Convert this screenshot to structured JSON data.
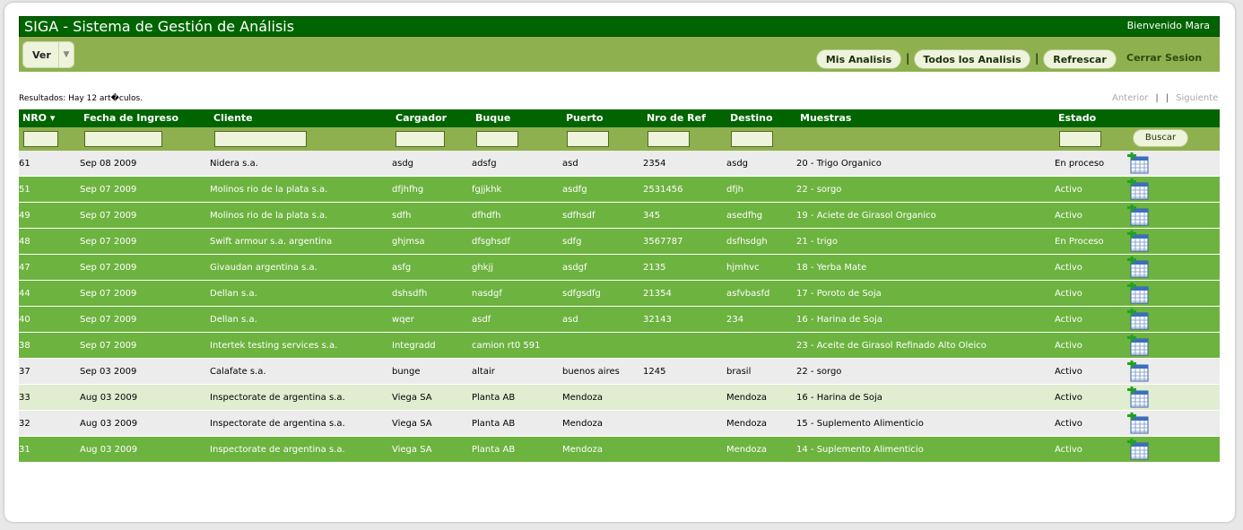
{
  "header": {
    "title": "SIGA - Sistema de Gestión de Análisis",
    "welcome": "Bienvenido Mara"
  },
  "toolbar": {
    "ver_label": "Ver",
    "mis_analisis": "Mis Analisis",
    "todos_analisis": "Todos los Analisis",
    "refrescar": "Refrescar",
    "separator": "|",
    "cerrar_sesion": "Cerrar Sesion"
  },
  "results_text": "Resultados: Hay 12 art�culos.",
  "pager": {
    "prev": "Anterior",
    "next": "Siguiente",
    "bar": "|"
  },
  "table": {
    "columns": [
      "NRO ▾",
      "Fecha de Ingreso",
      "Cliente",
      "Cargador",
      "Buque",
      "Puerto",
      "Nro de Ref",
      "Destino",
      "Muestras",
      "Estado"
    ],
    "search_button": "Buscar",
    "rows": [
      [
        "61",
        "Sep 08 2009",
        "Nidera s.a.",
        "asdg",
        "adsfg",
        "asd",
        "2354",
        "asdg",
        "20 - Trigo Organico",
        "En proceso"
      ],
      [
        "51",
        "Sep 07 2009",
        "Molinos rio de la plata s.a.",
        "dfjhfhg",
        "fgjjkhk",
        "asdfg",
        "2531456",
        "dfjh",
        "22 - sorgo",
        "Activo"
      ],
      [
        "49",
        "Sep 07 2009",
        "Molinos rio de la plata s.a.",
        "sdfh",
        "dfhdfh",
        "sdfhsdf",
        "345",
        "asedfhg",
        "19 - Aciete de Girasol Organico",
        "Activo"
      ],
      [
        "48",
        "Sep 07 2009",
        "Swift armour s.a. argentina",
        "ghjmsa",
        "dfsghsdf",
        "sdfg",
        "3567787",
        "dsfhsdgh",
        "21 - trigo",
        "En Proceso"
      ],
      [
        "47",
        "Sep 07 2009",
        "Givaudan argentina s.a.",
        "asfg",
        "ghkjj",
        "asdgf",
        "2135",
        "hjmhvc",
        "18 - Yerba Mate",
        "Activo"
      ],
      [
        "44",
        "Sep 07 2009",
        "Dellan s.a.",
        "dshsdfh",
        "nasdgf",
        "sdfgsdfg",
        "21354",
        "asfvbasfd",
        "17 - Poroto de Soja",
        "Activo"
      ],
      [
        "40",
        "Sep 07 2009",
        "Dellan s.a.",
        "wqer",
        "asdf",
        "asd",
        "32143",
        "234",
        "16 - Harina de Soja",
        "Activo"
      ],
      [
        "38",
        "Sep 07 2009",
        "Intertek testing services s.a.",
        "Integradd",
        "camion rt0 591",
        "",
        "",
        "",
        "23 - Aceite de Girasol Refinado Alto Oleico",
        "Activo"
      ],
      [
        "37",
        "Sep 03 2009",
        "Calafate s.a.",
        "bunge",
        "altair",
        "buenos aires",
        "1245",
        "brasil",
        "22 - sorgo",
        "Activo"
      ],
      [
        "33",
        "Aug 03 2009",
        "Inspectorate de argentina s.a.",
        "Viega SA",
        "Planta AB",
        "Mendoza",
        "",
        "Mendoza",
        "16 - Harina de Soja",
        "Activo"
      ],
      [
        "32",
        "Aug 03 2009",
        "Inspectorate de argentina s.a.",
        "Viega SA",
        "Planta AB",
        "Mendoza",
        "",
        "Mendoza",
        "15 - Suplemento Alimenticio",
        "Activo"
      ],
      [
        "31",
        "Aug 03 2009",
        "Inspectorate de argentina s.a.",
        "Viega SA",
        "Planta AB",
        "Mendoza",
        "",
        "Mendoza",
        "14 - Suplemento Alimenticio",
        "Activo"
      ]
    ],
    "row_styles": [
      "white",
      "green",
      "green",
      "green",
      "green",
      "green",
      "green",
      "green",
      "white",
      "light",
      "white",
      "green"
    ],
    "action_icon": "add-calendar-icon"
  },
  "colors": {
    "dark_green": "#006400",
    "olive_green": "#8fb04e",
    "row_green": "#6db33f",
    "row_light": "#e0edd0",
    "row_white": "#ececec"
  }
}
